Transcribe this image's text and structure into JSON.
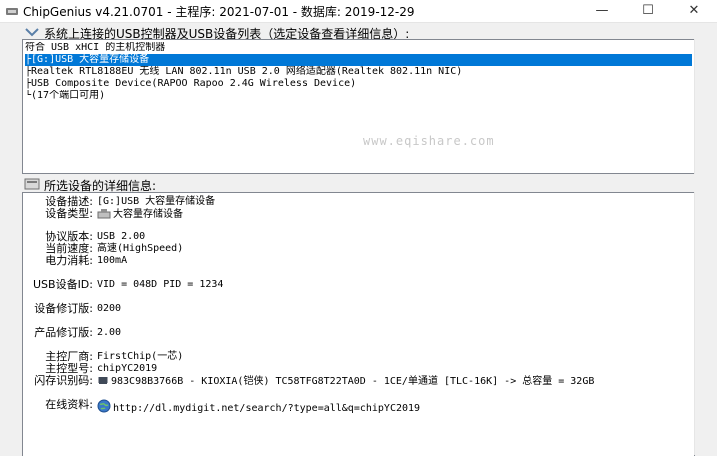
{
  "window": {
    "title": "ChipGenius v4.21.0701 - 主程序: 2021-07-01 - 数据库: 2019-12-29",
    "minimize_glyph": "—",
    "maximize_glyph": "☐",
    "close_glyph": "✕"
  },
  "device_list": {
    "heading": "系统上连接的USB控制器及USB设备列表（选定设备查看详细信息）:",
    "items": [
      "符合 USB xHCI 的主机控制器",
      "├[G:]USB 大容量存储设备",
      "├Realtek RTL8188EU 无线 LAN 802.11n USB 2.0 网络适配器(Realtek 802.11n NIC)",
      "├USB Composite Device(RAPOO Rapoo 2.4G Wireless Device)",
      "└(17个端口可用)"
    ],
    "selected_index": 1,
    "watermark": "www.eqishare.com"
  },
  "details": {
    "heading": "所选设备的详细信息:",
    "rows": [
      {
        "label": "设备描述:",
        "value": "[G:]USB 大容量存储设备"
      },
      {
        "label": "设备类型:",
        "value": "大容量存储设备",
        "icon": "usb-drive-icon"
      },
      {
        "label": "协议版本:",
        "value": "USB 2.00"
      },
      {
        "label": "当前速度:",
        "value": "高速(HighSpeed)"
      },
      {
        "label": "电力消耗:",
        "value": "100mA"
      },
      {
        "label": "USB设备ID:",
        "value": "VID = 048D PID = 1234"
      },
      {
        "label": "设备修订版:",
        "value": "0200"
      },
      {
        "label": "产品修订版:",
        "value": "2.00"
      },
      {
        "label": "主控厂商:",
        "value": "FirstChip(一芯)"
      },
      {
        "label": "主控型号:",
        "value": "chipYC2019"
      },
      {
        "label": "闪存识别码:",
        "value": "983C98B3766B - KIOXIA(铠侠) TC58TFG8T22TA0D - 1CE/单通道 [TLC-16K] -> 总容量 = 32GB",
        "icon": "chip-icon"
      },
      {
        "label": "在线资料:",
        "value": "http://dl.mydigit.net/search/?type=all&q=chipYC2019",
        "icon": "globe-icon"
      }
    ]
  },
  "colors": {
    "selection": "#0078d7",
    "list_border": "#828790",
    "window_bg": "#f0f0f0"
  }
}
